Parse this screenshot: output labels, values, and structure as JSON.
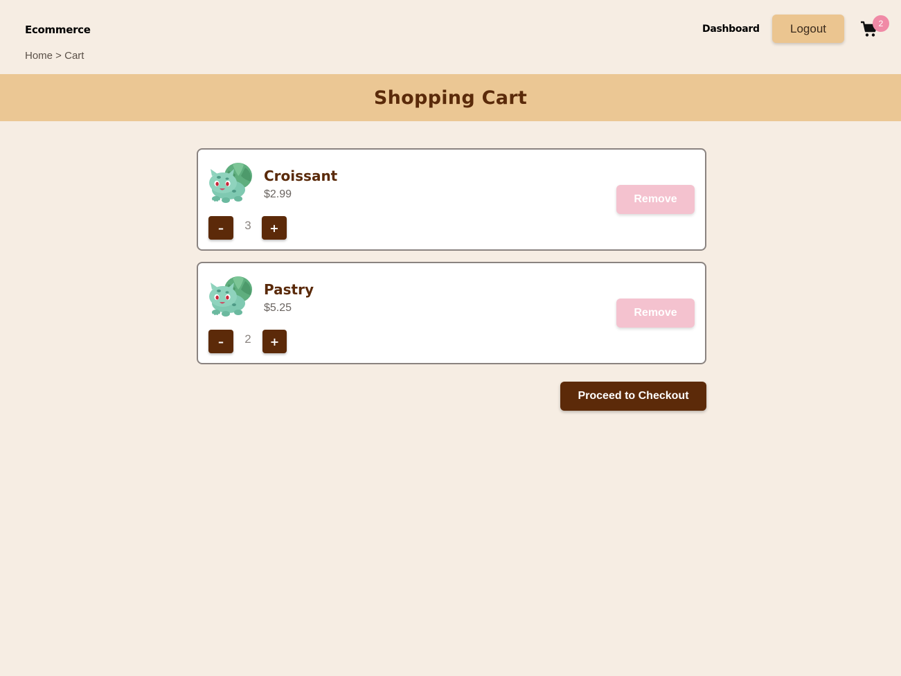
{
  "header": {
    "brand": "Ecommerce",
    "breadcrumb": {
      "home": "Home",
      "separator": " > ",
      "current": "Cart"
    },
    "nav": {
      "dashboard": "Dashboard",
      "logout": "Logout"
    },
    "cart": {
      "icon": "cart-icon",
      "count": "2"
    }
  },
  "page": {
    "title": "Shopping Cart"
  },
  "cart_items": [
    {
      "name": "Croissant",
      "price": "$2.99",
      "quantity": "3",
      "decrement_label": "–",
      "increment_label": "+",
      "remove_label": "Remove",
      "image_icon": "bulbasaur-image"
    },
    {
      "name": "Pastry",
      "price": "$5.25",
      "quantity": "2",
      "decrement_label": "–",
      "increment_label": "+",
      "remove_label": "Remove",
      "image_icon": "bulbasaur-image"
    }
  ],
  "checkout": {
    "label": "Proceed to Checkout"
  },
  "colors": {
    "background": "#f6ede3",
    "hero_band": "#ebc794",
    "primary_brown": "#5c2a09",
    "logout_button": "#ebc590",
    "remove_button": "#f4c2cf",
    "badge": "#f08aa6"
  }
}
